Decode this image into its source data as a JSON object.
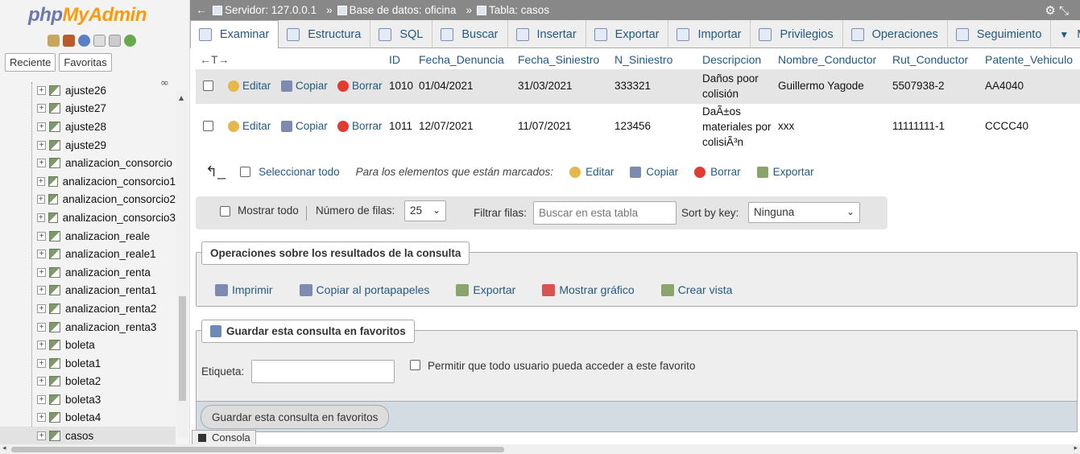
{
  "app": {
    "logo_php": "php",
    "logo_my": "MyAdmin",
    "nav_tabs": [
      "Reciente",
      "Favoritas"
    ]
  },
  "tree": {
    "items": [
      "ajuste26",
      "ajuste27",
      "ajuste28",
      "ajuste29",
      "analizacion_consorcio",
      "analizacion_consorcio1",
      "analizacion_consorcio2",
      "analizacion_consorcio3",
      "analizacion_reale",
      "analizacion_reale1",
      "analizacion_renta",
      "analizacion_renta1",
      "analizacion_renta2",
      "analizacion_renta3",
      "boleta",
      "boleta1",
      "boleta2",
      "boleta3",
      "boleta4",
      "casos"
    ],
    "active": "casos"
  },
  "breadcrumb": {
    "server": "Servidor: 127.0.0.1",
    "database": "Base de datos: oficina",
    "table": "Tabla: casos"
  },
  "tabs": [
    "Examinar",
    "Estructura",
    "SQL",
    "Buscar",
    "Insertar",
    "Exportar",
    "Importar",
    "Privilegios",
    "Operaciones",
    "Seguimiento",
    "M"
  ],
  "table": {
    "columns": [
      "ID",
      "Fecha_Denuncia",
      "Fecha_Siniestro",
      "N_Siniestro",
      "Descripcion",
      "Nombre_Conductor",
      "Rut_Conductor",
      "Patente_Vehiculo"
    ],
    "actions": {
      "edit": "Editar",
      "copy": "Copiar",
      "delete": "Borrar"
    },
    "rows": [
      {
        "id": "1010",
        "fecha_denuncia": "01/04/2021",
        "fecha_siniestro": "31/03/2021",
        "n_siniestro": "333321",
        "descripcion": "Daños poor colisión",
        "nombre": "Guillermo Yagode",
        "rut": "5507938-2",
        "patente": "AA4040"
      },
      {
        "id": "1011",
        "fecha_denuncia": "12/07/2021",
        "fecha_siniestro": "11/07/2021",
        "n_siniestro": "123456",
        "descripcion": "DaÃ±os materiales por colisiÃ³n",
        "nombre": "xxx",
        "rut": "11111111-1",
        "patente": "CCCC40"
      }
    ]
  },
  "selection": {
    "select_all": "Seleccionar todo",
    "marked_label": "Para los elementos que están marcados:",
    "edit": "Editar",
    "copy": "Copiar",
    "delete": "Borrar",
    "export": "Exportar"
  },
  "filters": {
    "show_all": "Mostrar todo",
    "rows_label": "Número de filas:",
    "rows_value": "25",
    "filter_label": "Filtrar filas:",
    "filter_placeholder": "Buscar en esta tabla",
    "sort_label": "Sort by key:",
    "sort_value": "Ninguna"
  },
  "query_ops": {
    "legend": "Operaciones sobre los resultados de la consulta",
    "print": "Imprimir",
    "copy_clipboard": "Copiar al portapapeles",
    "export": "Exportar",
    "chart": "Mostrar gráfico",
    "view": "Crear vista"
  },
  "favorite": {
    "legend": "Guardar esta consulta en favoritos",
    "label": "Etiqueta:",
    "allow_all": "Permitir que todo usuario pueda acceder a este favorito",
    "submit": "Guardar esta consulta en favoritos"
  },
  "console": "Consola"
}
